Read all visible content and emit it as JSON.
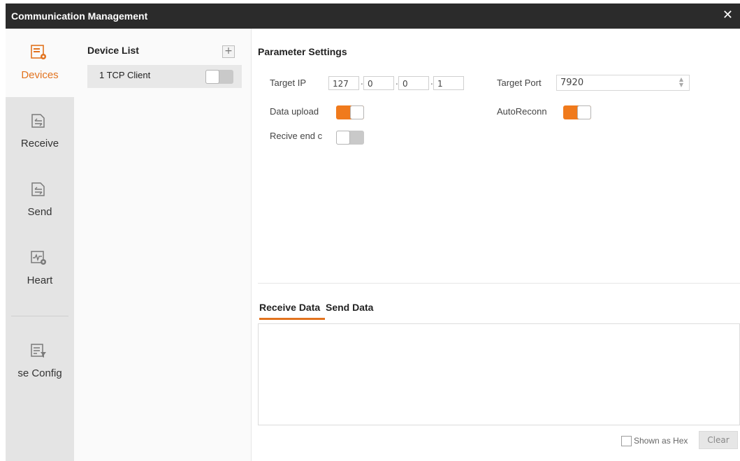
{
  "window": {
    "title": "Communication Management",
    "close_glyph": "✕"
  },
  "nav": {
    "items": [
      {
        "label": "Devices",
        "icon": "devices-icon",
        "active": true
      },
      {
        "label": "Receive",
        "icon": "receive-icon",
        "active": false
      },
      {
        "label": "Send",
        "icon": "send-icon",
        "active": false
      },
      {
        "label": "Heart",
        "icon": "heartbeat-icon",
        "active": false
      },
      {
        "label": "se Config",
        "icon": "config-icon",
        "active": false
      }
    ]
  },
  "device_list": {
    "header": "Device List",
    "add_glyph": "+",
    "devices": [
      {
        "name": "1 TCP Client",
        "enabled": false
      }
    ]
  },
  "params": {
    "header": "Parameter Settings",
    "target_ip_label": "Target IP",
    "target_ip": [
      "127",
      "0",
      "0",
      "1"
    ],
    "target_port_label": "Target Port",
    "target_port": "7920",
    "data_upload_label": "Data upload",
    "data_upload": true,
    "auto_reconnect_label": "AutoReconn",
    "auto_reconnect": true,
    "receive_end_label": "Recive end c",
    "receive_end": false
  },
  "tabs": [
    {
      "label": "Receive Data",
      "active": true
    },
    {
      "label": "Send Data",
      "active": false
    }
  ],
  "footer": {
    "hex_label": "Shown as Hex",
    "hex_checked": false,
    "clear_label": "Clear"
  },
  "colors": {
    "accent": "#e2731f",
    "toggle_on": "#f07a1c",
    "titlebar": "#2b2b2b"
  }
}
